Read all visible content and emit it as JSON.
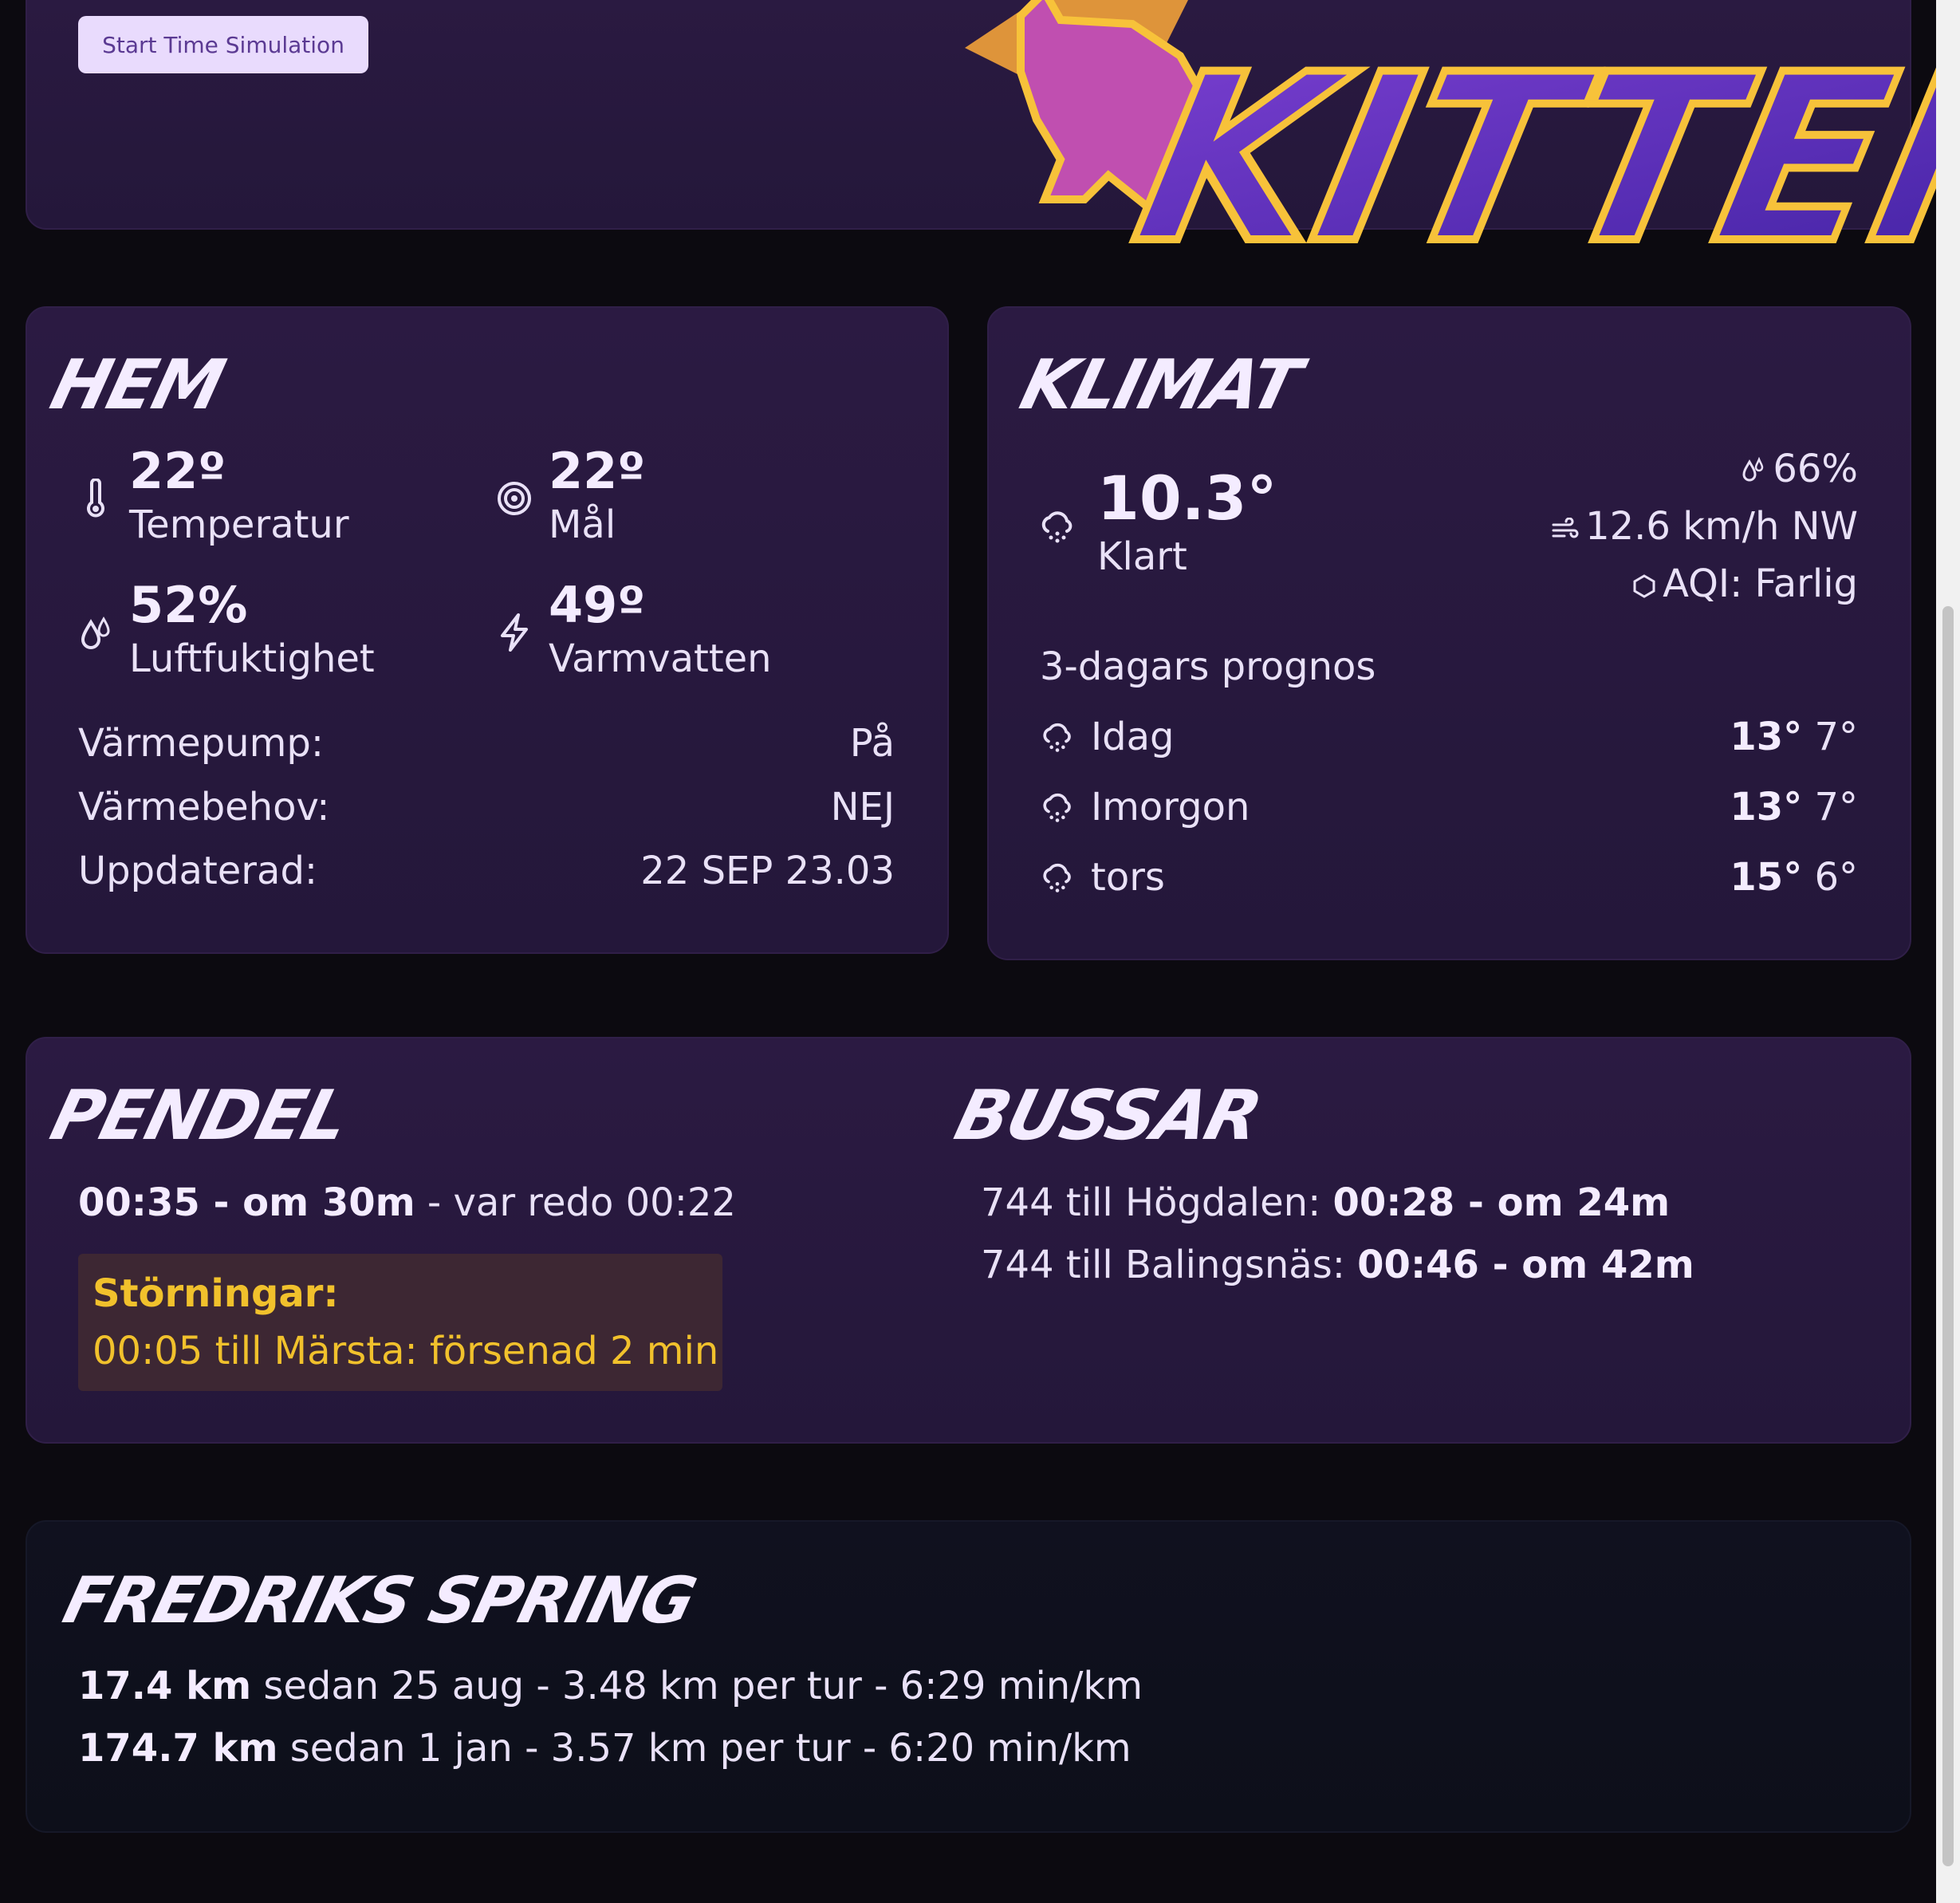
{
  "sim_button": "Start Time Simulation",
  "logo_text": "KITTENS",
  "hem": {
    "title": "HEM",
    "tiles": [
      {
        "value": "22º",
        "label": "Temperatur",
        "icon": "thermometer-icon"
      },
      {
        "value": "22º",
        "label": "Mål",
        "icon": "target-icon"
      },
      {
        "value": "52%",
        "label": "Luftfuktighet",
        "icon": "humidity-icon"
      },
      {
        "value": "49º",
        "label": "Varmvatten",
        "icon": "bolt-icon"
      }
    ],
    "rows": [
      {
        "key": "Värmepump:",
        "value": "På"
      },
      {
        "key": "Värmebehov:",
        "value": "NEJ"
      },
      {
        "key": "Uppdaterad:",
        "value": "22 SEP 23.03"
      }
    ]
  },
  "klimat": {
    "title": "KLIMAT",
    "temp": "10.3°",
    "condition": "Klart",
    "humidity": "66%",
    "wind": "12.6 km/h NW",
    "aqi": "AQI: Farlig",
    "forecast_title": "3-dagars prognos",
    "forecast": [
      {
        "day": "Idag",
        "high": "13°",
        "low": "7°"
      },
      {
        "day": "Imorgon",
        "high": "13°",
        "low": "7°"
      },
      {
        "day": "tors",
        "high": "15°",
        "low": "6°"
      }
    ]
  },
  "pendel": {
    "title": "PENDEL",
    "departure_bold": "00:35 - om 30m",
    "departure_rest": " - var redo 00:22",
    "disruption_title": "Störningar:",
    "disruption_text": "00:05 till Märsta: försenad 2 min"
  },
  "bussar": {
    "title": "BUSSAR",
    "lines": [
      {
        "prefix": "744 till Högdalen: ",
        "time": "00:28 - om 24m"
      },
      {
        "prefix": "744 till Balingsnäs: ",
        "time": "00:46 - om 42m"
      }
    ]
  },
  "spring": {
    "title": "FREDRIKS SPRING",
    "lines": [
      {
        "km": "17.4 km",
        "rest": " sedan 25 aug - 3.48 km per tur - 6:29 min/km"
      },
      {
        "km": "174.7 km",
        "rest": " sedan 1 jan - 3.57 km per tur - 6:20 min/km"
      }
    ]
  }
}
